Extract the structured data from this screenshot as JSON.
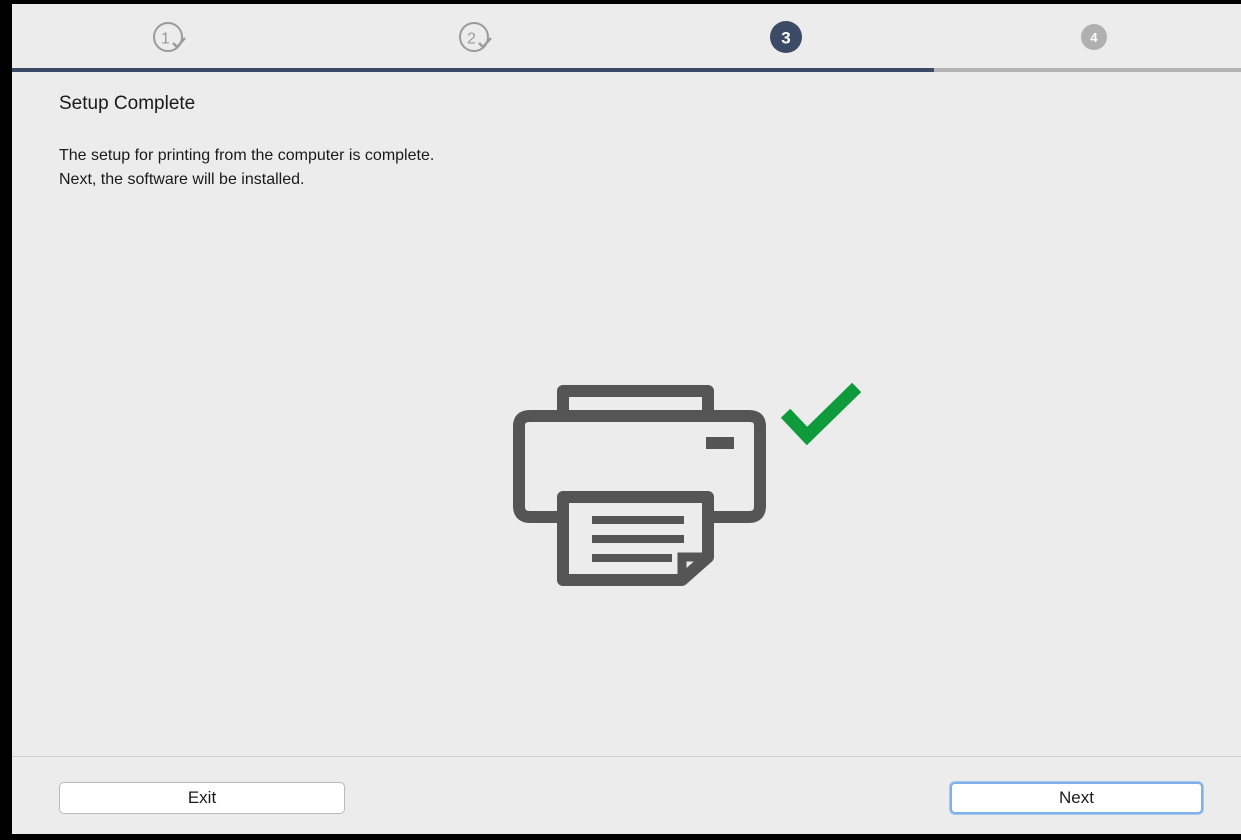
{
  "steps": [
    {
      "number": "1",
      "state": "completed"
    },
    {
      "number": "2",
      "state": "completed"
    },
    {
      "number": "3",
      "state": "current"
    },
    {
      "number": "4",
      "state": "upcoming"
    }
  ],
  "progress_percent": 75,
  "colors": {
    "step_current": "#3b4b65",
    "step_upcoming": "#b0b0b0",
    "step_completed": "#9a9a9a",
    "checkmark": "#0f9a3c",
    "printer": "#555555"
  },
  "page": {
    "title": "Setup Complete",
    "description_lines": [
      "The setup for printing from the computer is complete.",
      "Next, the software will be installed."
    ]
  },
  "illustration": {
    "icons": [
      "printer-icon",
      "checkmark-icon"
    ]
  },
  "buttons": {
    "exit": "Exit",
    "next": "Next"
  }
}
